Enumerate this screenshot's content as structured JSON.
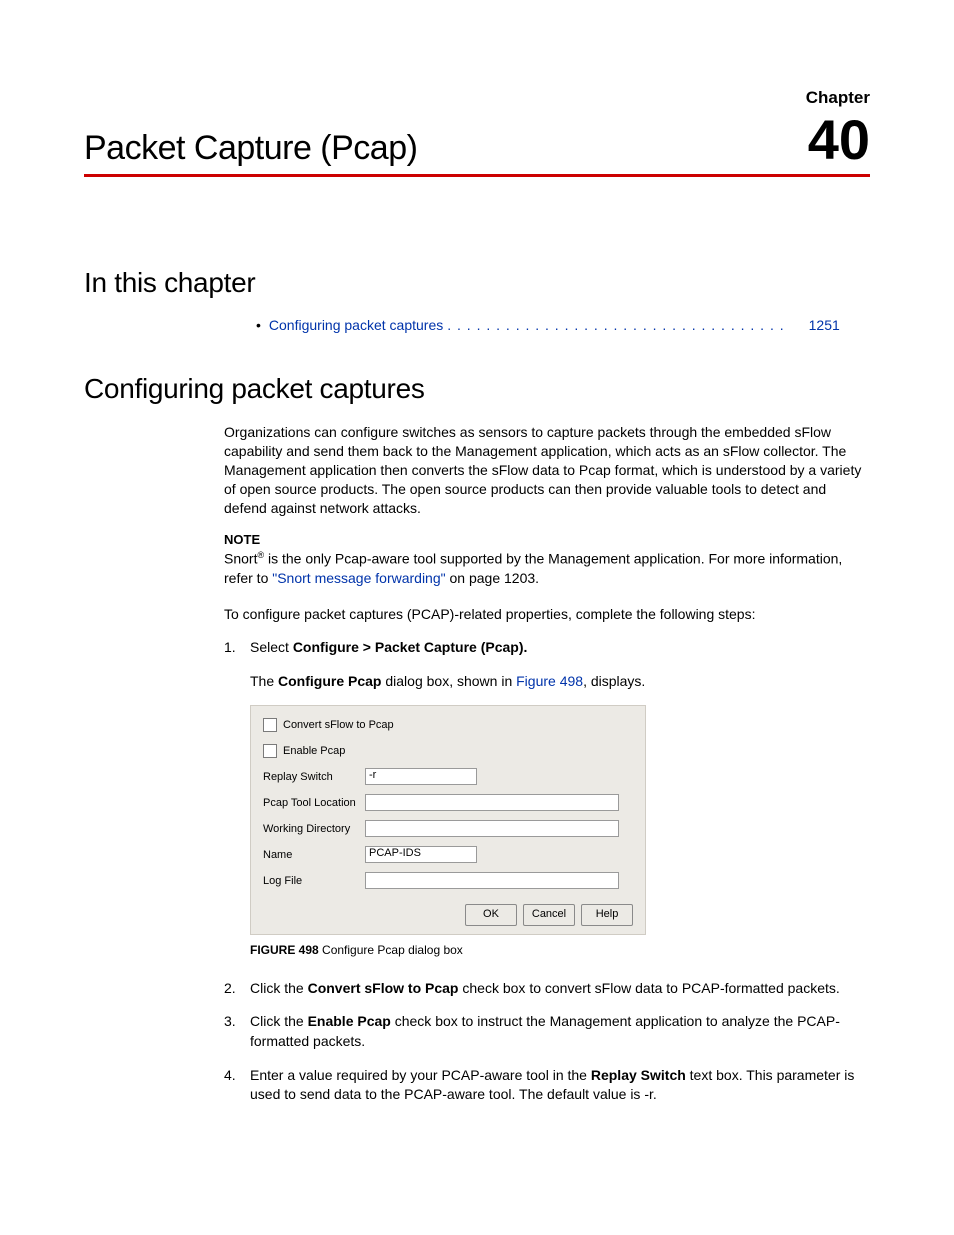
{
  "header": {
    "chapter_label": "Chapter",
    "chapter_number": "40",
    "title": "Packet Capture (Pcap)"
  },
  "sections": {
    "in_this_chapter": "In this chapter",
    "configuring": "Configuring packet captures"
  },
  "toc": {
    "bullet": "•",
    "link_text": "Configuring packet captures",
    "dots": ". . . . . . . . . . . . . . . . . . . . . . . . . . . . . . . . . . .",
    "page": "1251"
  },
  "body": {
    "intro": "Organizations can configure switches as sensors to capture packets through the embedded sFlow capability and send them back to the Management application, which acts as an sFlow collector. The Management application then converts the sFlow data to Pcap format, which is understood by a variety of open source products. The open source products can then provide valuable tools to detect and defend against network attacks.",
    "note_label": "NOTE",
    "note_pre": "Snort",
    "note_reg": "®",
    "note_mid": " is the only Pcap-aware tool supported by the Management application. For more information, refer to ",
    "note_link": "\"Snort message forwarding\"",
    "note_post": " on page 1203.",
    "lead": "To configure packet captures (PCAP)-related properties, complete the following steps:"
  },
  "steps": {
    "s1a": "Select ",
    "s1b": "Configure > Packet Capture (Pcap).",
    "s1sub_a": "The ",
    "s1sub_b": "Configure Pcap",
    "s1sub_c": " dialog box, shown in ",
    "s1sub_link": "Figure 498",
    "s1sub_d": ", displays.",
    "s2a": "Click the ",
    "s2b": "Convert sFlow to Pcap",
    "s2c": " check box to convert sFlow data to PCAP-formatted packets.",
    "s3a": "Click the ",
    "s3b": "Enable Pcap",
    "s3c": " check box to instruct the Management application to analyze the PCAP-formatted packets.",
    "s4a": "Enter a value required by your PCAP-aware tool in the ",
    "s4b": "Replay Switch",
    "s4c": " text box. This parameter is used to send data to the PCAP-aware tool. The default value is -r."
  },
  "dialog": {
    "convert_label": "Convert sFlow to Pcap",
    "enable_label": "Enable Pcap",
    "replay_label": "Replay Switch",
    "replay_value": "-r",
    "tool_label": "Pcap Tool Location",
    "workdir_label": "Working Directory",
    "name_label": "Name",
    "name_value": "PCAP-IDS",
    "logfile_label": "Log File",
    "ok": "OK",
    "cancel": "Cancel",
    "help": "Help"
  },
  "figure": {
    "label": "FIGURE 498",
    "caption": "   Configure Pcap dialog box"
  }
}
